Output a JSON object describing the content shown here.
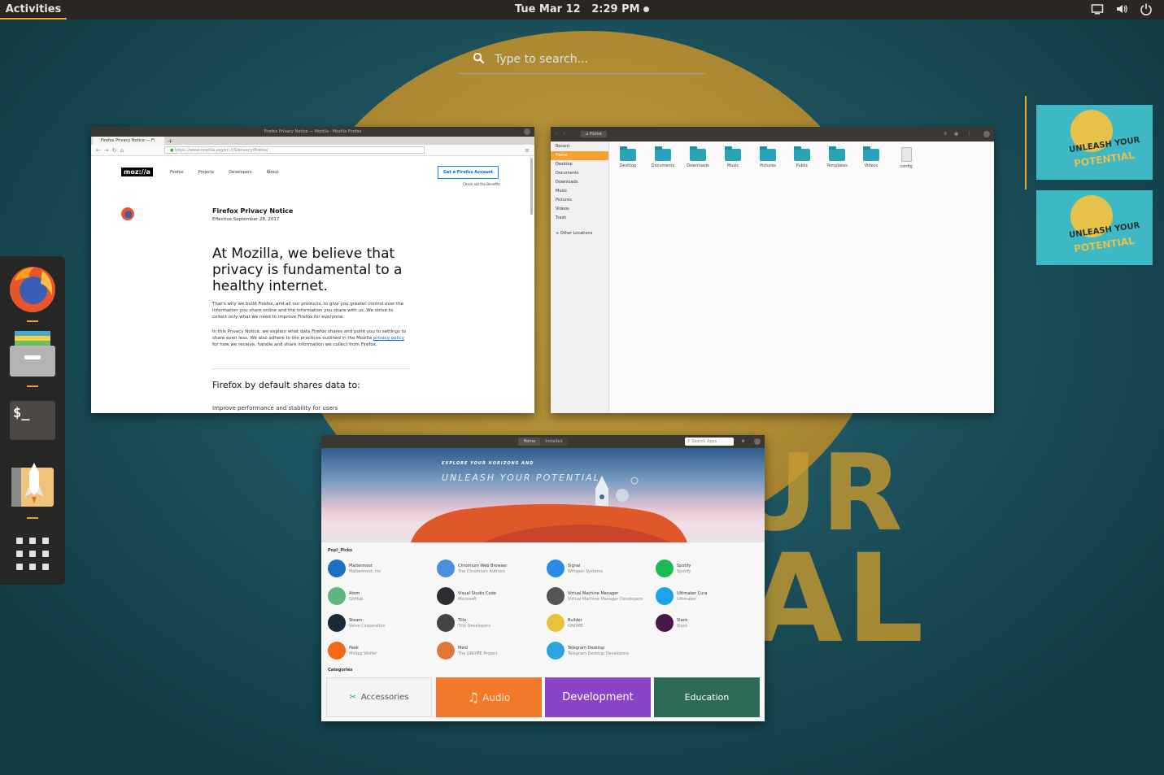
{
  "topbar": {
    "activities": "Activities",
    "date": "Tue Mar 12",
    "time": "2:29 PM",
    "tray_icons": [
      "screen-icon",
      "volume-icon",
      "power-icon"
    ]
  },
  "search": {
    "placeholder": "Type to search..."
  },
  "dash": {
    "apps": [
      "Firefox",
      "Files",
      "Terminal",
      "Pop!_Shop",
      "Show Applications"
    ]
  },
  "firefox": {
    "window_title": "Firefox Privacy Notice — Mozilla - Mozilla Firefox",
    "tab_label": "Firefox Privacy Notice — Fi",
    "url": "https://www.mozilla.org/en-US/privacy/firefox/",
    "logo": "moz://a",
    "nav": [
      "Firefox",
      "Projects",
      "Developers",
      "About"
    ],
    "account_button": "Get a Firefox Account",
    "account_sub": "Check out the Benefits",
    "notice_title": "Firefox Privacy Notice",
    "effective": "Effective September 28, 2017",
    "headline": "At Mozilla, we believe that privacy is fundamental to a healthy internet.",
    "para1": "That's why we build Firefox, and all our products, to give you greater control over the information you share online and the information you share with us. We strive to collect only what we need to improve Firefox for everyone.",
    "para2_a": "In this Privacy Notice, we explain what data Firefox shares and point you to settings to share even less. We also adhere to the practices outlined in the Mozilla",
    "para2_link": "privacy policy",
    "para2_b": "for how we receive, handle and share information we collect from Firefox.",
    "subhead": "Firefox by default shares data to:",
    "cut_line": "Improve performance and stability for users"
  },
  "files": {
    "path": "Home",
    "sidebar": [
      "Recent",
      "Home",
      "Desktop",
      "Documents",
      "Downloads",
      "Music",
      "Pictures",
      "Videos",
      "Trash",
      "+ Other Locations"
    ],
    "folders": [
      "Desktop",
      "Documents",
      "Downloads",
      "Music",
      "Pictures",
      "Public",
      "Templates",
      "Videos"
    ],
    "file": "config"
  },
  "shop": {
    "tabs": [
      "Home",
      "Installed"
    ],
    "search_placeholder": "Search Apps",
    "banner_line1": "EXPLORE YOUR HORIZONS AND",
    "banner_line2": "UNLEASH YOUR POTENTIAL",
    "section": "Pop!_Picks",
    "apps": [
      {
        "name": "Mattermost",
        "dev": "Mattermost, Inc",
        "color": "#1e6fc2"
      },
      {
        "name": "Chromium Web Browser",
        "dev": "The Chromium Authors",
        "color": "#4a8ee0"
      },
      {
        "name": "Signal",
        "dev": "Whisper Systems",
        "color": "#2b8ae6"
      },
      {
        "name": "Spotify",
        "dev": "Spotify",
        "color": "#1db954"
      },
      {
        "name": "Atom",
        "dev": "GitHub",
        "color": "#5fb57d"
      },
      {
        "name": "Visual Studio Code",
        "dev": "Microsoft",
        "color": "#2c2c32"
      },
      {
        "name": "Virtual Machine Manager",
        "dev": "Virtual Machine Manager Developers",
        "color": "#555555"
      },
      {
        "name": "Ultimaker Cura",
        "dev": "Ultimaker",
        "color": "#1aa3e6"
      },
      {
        "name": "Steam",
        "dev": "Valve Corporation",
        "color": "#1b2838"
      },
      {
        "name": "Tilix",
        "dev": "Tilix Developers",
        "color": "#444444"
      },
      {
        "name": "Builder",
        "dev": "GNOME",
        "color": "#e8c23a"
      },
      {
        "name": "Slack",
        "dev": "Slack",
        "color": "#4a154b"
      },
      {
        "name": "Peek",
        "dev": "Philipp Wolfer",
        "color": "#f06a1c"
      },
      {
        "name": "Meld",
        "dev": "The GNOME Project",
        "color": "#e0763a"
      },
      {
        "name": "Telegram Desktop",
        "dev": "Telegram Desktop Developers",
        "color": "#2ca5e0"
      }
    ],
    "categories_label": "Categories",
    "categories": [
      {
        "label": "Accessories",
        "color": "#f4f4f4"
      },
      {
        "label": "Audio",
        "color": "#f07a2a"
      },
      {
        "label": "Development",
        "color": "#8a44c8"
      },
      {
        "label": "Education",
        "color": "#2e6b55"
      }
    ]
  },
  "background": {
    "words": [
      "UR",
      "AL"
    ]
  },
  "workspaces": [
    {
      "label_line1": "UNLEASH YOUR",
      "label_line2": "POTENTIAL"
    },
    {
      "label_line1": "UNLEASH YOUR",
      "label_line2": "POTENTIAL"
    }
  ]
}
